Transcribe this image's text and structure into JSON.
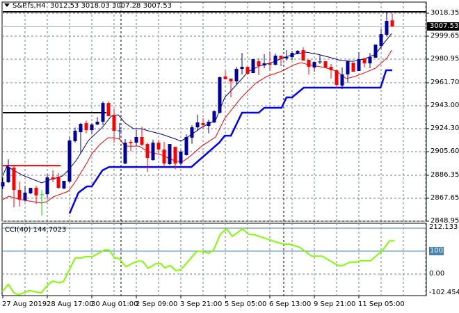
{
  "header": {
    "symbol": "S&P.fs,H4",
    "open": "3012.53",
    "high": "3018.03",
    "low": "3007.28",
    "close": "3007.53"
  },
  "colors": {
    "bull": "#0000a0",
    "bear": "#ff0000",
    "doji_special": "#00e000",
    "ma_fast": "#000080",
    "ma_slow": "#ff0000",
    "stop_line": "#0000ff",
    "cci_line": "#80ff00",
    "level_line": "#4682b4",
    "grid": "#708090"
  },
  "price_axis": {
    "labels": [
      "3018.35",
      "2999.65",
      "2980.95",
      "2961.70",
      "2943.00",
      "2924.30",
      "2905.60",
      "2886.35",
      "2867.65",
      "2848.95"
    ],
    "current_price": "3007.53",
    "range": [
      2848.95,
      3018.35
    ]
  },
  "time_axis": {
    "labels": [
      "27 Aug 2019",
      "28 Aug 17:00",
      "30 Aug 01:00",
      "2 Sep 09:00",
      "3 Sep 21:00",
      "5 Sep 05:00",
      "6 Sep 13:00",
      "9 Sep 21:00",
      "11 Sep 05:00"
    ]
  },
  "chart_data": {
    "type": "candlestick",
    "candles": [
      [
        2877.3,
        2884.6,
        2875.0,
        2880.7
      ],
      [
        2880.7,
        2899.3,
        2880.1,
        2893.1
      ],
      [
        2892.5,
        2894.2,
        2860.3,
        2874.4
      ],
      [
        2874.4,
        2881.2,
        2861.0,
        2866.5
      ],
      [
        2866.0,
        2877.6,
        2864.8,
        2872.2
      ],
      [
        2871.6,
        2875.2,
        2871.0,
        2876.1
      ],
      [
        2876.1,
        2877.8,
        2863.1,
        2869.9
      ],
      [
        2870.5,
        2874.4,
        2853.5,
        2870.5,
        "g"
      ],
      [
        2870.9,
        2887.4,
        2867.6,
        2884.6
      ],
      [
        2884.6,
        2890.3,
        2880.8,
        2882.9
      ],
      [
        2885.2,
        2888.2,
        2875.2,
        2876.1
      ],
      [
        2875.6,
        2881.8,
        2875.0,
        2881.8
      ],
      [
        2881.2,
        2917.7,
        2880.1,
        2914.7
      ],
      [
        2914.1,
        2925.2,
        2912.9,
        2922.6
      ],
      [
        2921.4,
        2929.0,
        2904.5,
        2928.2
      ],
      [
        2928.8,
        2930.9,
        2920.5,
        2923.1
      ],
      [
        2923.1,
        2929.0,
        2919.6,
        2927.7
      ],
      [
        2927.7,
        2933.7,
        2927.1,
        2930.0
      ],
      [
        2930.0,
        2946.6,
        2927.1,
        2945.2
      ],
      [
        2945.2,
        2946.6,
        2934.5,
        2934.5
      ],
      [
        2935.6,
        2940.3,
        2912.9,
        2922.6
      ],
      [
        2922.6,
        2928.8,
        2915.8,
        2922.6,
        "u"
      ],
      [
        2895.9,
        2915.8,
        2895.4,
        2912.9
      ],
      [
        2913.5,
        2915.3,
        2906.0,
        2912.4
      ],
      [
        2912.9,
        2923.3,
        2910.1,
        2917.5
      ],
      [
        2917.5,
        2925.8,
        2910.1,
        2911.2
      ],
      [
        2911.8,
        2912.9,
        2889.2,
        2900.5
      ],
      [
        2898.8,
        2915.4,
        2898.2,
        2912.9
      ],
      [
        2912.9,
        2915.4,
        2904.0,
        2907.3
      ],
      [
        2907.3,
        2913.5,
        2894.1,
        2895.9
      ],
      [
        2895.4,
        2911.8,
        2894.6,
        2911.8
      ],
      [
        2909.5,
        2909.5,
        2891.2,
        2895.9
      ],
      [
        2895.9,
        2906.9,
        2894.8,
        2905.6
      ],
      [
        2902.8,
        2919.7,
        2902.4,
        2917.5
      ],
      [
        2917.0,
        2927.1,
        2912.0,
        2925.4
      ],
      [
        2925.4,
        2935.6,
        2922.6,
        2929.4
      ],
      [
        2928.8,
        2932.8,
        2924.3,
        2927.1
      ],
      [
        2926.5,
        2931.7,
        2920.5,
        2930.0
      ],
      [
        2929.4,
        2939.4,
        2928.8,
        2938.5
      ],
      [
        2937.3,
        2966.8,
        2936.6,
        2966.2
      ],
      [
        2966.8,
        2971.5,
        2964.5,
        2964.5
      ],
      [
        2965.1,
        2965.1,
        2949.8,
        2962.8
      ],
      [
        2962.8,
        2974.7,
        2960.1,
        2973.0
      ],
      [
        2973.0,
        2986.0,
        2968.5,
        2974.7
      ],
      [
        2974.7,
        2974.7,
        2968.5,
        2969.0
      ],
      [
        2969.6,
        2980.9,
        2969.6,
        2980.9
      ],
      [
        2979.2,
        2981.5,
        2967.9,
        2975.3
      ],
      [
        2975.8,
        2984.9,
        2973.6,
        2977.5
      ],
      [
        2977.5,
        2987.2,
        2971.3,
        2976.4
      ],
      [
        2976.4,
        2985.5,
        2975.8,
        2983.8
      ],
      [
        2983.8,
        2983.8,
        2975.3,
        2981.5
      ],
      [
        2981.5,
        2988.3,
        2979.8,
        2982.6
      ],
      [
        2982.6,
        2987.7,
        2980.4,
        2986.0
      ],
      [
        2985.5,
        2988.3,
        2984.9,
        2987.7
      ],
      [
        2988.3,
        2990.7,
        2979.8,
        2979.8
      ],
      [
        2980.4,
        2980.4,
        2968.5,
        2974.7
      ],
      [
        2974.1,
        2978.7,
        2970.7,
        2978.7
      ],
      [
        2978.7,
        2984.4,
        2977.0,
        2978.7,
        "u"
      ],
      [
        2979.2,
        2979.2,
        2973.6,
        2974.1
      ],
      [
        2974.7,
        2977.0,
        2965.1,
        2971.9
      ],
      [
        2971.9,
        2971.9,
        2957.1,
        2960.0
      ],
      [
        2959.4,
        2974.1,
        2956.6,
        2968.5
      ],
      [
        2968.5,
        2979.8,
        2961.7,
        2979.2
      ],
      [
        2978.1,
        2978.1,
        2970.7,
        2970.7
      ],
      [
        2971.3,
        2986.6,
        2971.3,
        2980.9
      ],
      [
        2981.5,
        2982.1,
        2974.1,
        2977.5
      ],
      [
        2977.5,
        2986.0,
        2973.6,
        2982.6
      ],
      [
        2982.1,
        2992.8,
        2982.1,
        2992.8
      ],
      [
        2991.7,
        3005.3,
        2989.4,
        3001.3
      ],
      [
        3000.8,
        3019.5,
        2999.6,
        3012.1
      ],
      [
        3012.53,
        3018.03,
        3007.28,
        3007.53
      ]
    ],
    "ma_fast": [
      [
        1,
        2886.3
      ],
      [
        1.75,
        2893.7
      ],
      [
        3,
        2890.3
      ],
      [
        4.6,
        2886.3
      ],
      [
        8,
        2880.1
      ],
      [
        8.9,
        2881.8
      ],
      [
        11.75,
        2885.8
      ],
      [
        12.75,
        2890.3
      ],
      [
        14.25,
        2898.8
      ],
      [
        16.4,
        2914.7
      ],
      [
        18.9,
        2925.4
      ],
      [
        20.5,
        2934.5
      ],
      [
        21.75,
        2935.6
      ],
      [
        23,
        2928.8
      ],
      [
        24.5,
        2924.3
      ],
      [
        25.9,
        2924.3
      ],
      [
        27.1,
        2922.6
      ],
      [
        29.6,
        2919.7
      ],
      [
        32.1,
        2915.8
      ],
      [
        33,
        2914.1
      ],
      [
        34.6,
        2918.6
      ],
      [
        36.75,
        2925.4
      ],
      [
        39.25,
        2931.1
      ],
      [
        40.9,
        2949.8
      ],
      [
        43,
        2960.0
      ],
      [
        45.1,
        2970.7
      ],
      [
        47.1,
        2975.3
      ],
      [
        49.25,
        2978.1
      ],
      [
        51.75,
        2982.6
      ],
      [
        53.4,
        2984.9
      ],
      [
        55.5,
        2986.6
      ],
      [
        57.6,
        2984.9
      ],
      [
        59.6,
        2982.6
      ],
      [
        61.75,
        2979.8
      ],
      [
        63.9,
        2979.2
      ],
      [
        65.9,
        2980.9
      ],
      [
        68,
        2984.9
      ],
      [
        69,
        2991.1
      ],
      [
        70.9,
        3001.9
      ]
    ],
    "ma_slow": [
      [
        1,
        2866.5
      ],
      [
        2.1,
        2869.3
      ],
      [
        4.25,
        2866.5
      ],
      [
        8,
        2863.7
      ],
      [
        8.9,
        2864.8
      ],
      [
        10.1,
        2868.8
      ],
      [
        12.75,
        2873.3
      ],
      [
        13.9,
        2880.1
      ],
      [
        15.9,
        2894.8
      ],
      [
        17.1,
        2904.5
      ],
      [
        18.4,
        2911.2
      ],
      [
        19.9,
        2916.9
      ],
      [
        20.9,
        2916.9
      ],
      [
        22,
        2915.8
      ],
      [
        23,
        2910.1
      ],
      [
        25.5,
        2910.1
      ],
      [
        27.1,
        2905.6
      ],
      [
        29.6,
        2902.8
      ],
      [
        32.1,
        2897.7
      ],
      [
        33.4,
        2897.7
      ],
      [
        34.6,
        2901.6
      ],
      [
        36.75,
        2910.1
      ],
      [
        39.25,
        2917.5
      ],
      [
        40.9,
        2932.8
      ],
      [
        43.9,
        2949.8
      ],
      [
        46.4,
        2961.1
      ],
      [
        48.4,
        2966.8
      ],
      [
        50.9,
        2970.7
      ],
      [
        53.4,
        2976.4
      ],
      [
        54.6,
        2978.1
      ],
      [
        55.9,
        2976.4
      ],
      [
        58.9,
        2974.1
      ],
      [
        60.9,
        2971.3
      ],
      [
        62.75,
        2965.1
      ],
      [
        64.25,
        2966.8
      ],
      [
        65.9,
        2969.6
      ],
      [
        68,
        2973.6
      ],
      [
        70.1,
        2982.1
      ],
      [
        70.9,
        2988.3
      ]
    ],
    "stop_line": [
      [
        13,
        2855.2
      ],
      [
        14.6,
        2872.2
      ],
      [
        16.1,
        2877.3
      ],
      [
        17,
        2877.3
      ],
      [
        18.9,
        2890.3
      ],
      [
        20.1,
        2893.1
      ],
      [
        34.9,
        2893.1
      ],
      [
        39.9,
        2912.9
      ],
      [
        40.9,
        2918.6
      ],
      [
        42,
        2918.6
      ],
      [
        44,
        2937.3
      ],
      [
        47,
        2937.3
      ],
      [
        48,
        2941.3
      ],
      [
        51.1,
        2941.3
      ],
      [
        52,
        2949.8
      ],
      [
        53,
        2949.8
      ],
      [
        55.1,
        2957.7
      ],
      [
        68.9,
        2957.7
      ],
      [
        69.9,
        2971.9
      ],
      [
        71,
        2971.9
      ]
    ],
    "hlines": [
      {
        "price": 3019.5,
        "from": 0,
        "to": 80,
        "color": "#000000"
      },
      {
        "price": 2937.3,
        "from": 0,
        "to": 19.6,
        "color": "#000000"
      },
      {
        "price": 2894.2,
        "from": 0,
        "to": 11.4,
        "color": "#ff0000"
      }
    ],
    "period_separators": [
      22.25,
      51.5
    ],
    "cci": {
      "label": "CCI(40) 144.7023",
      "period": 40,
      "value": 144.7023,
      "scale_labels": [
        "212.133",
        "100",
        "0.00",
        "-102.4547"
      ],
      "levels": [
        100,
        200,
        -100
      ],
      "range": [
        -102.4547,
        212.133
      ],
      "points": [
        [
          0.9,
          -76
        ],
        [
          2,
          -45
        ],
        [
          3,
          -82
        ],
        [
          3.9,
          -90
        ],
        [
          5.75,
          -72
        ],
        [
          7.9,
          -82
        ],
        [
          9.25,
          -43
        ],
        [
          10,
          -31
        ],
        [
          11.1,
          -38
        ],
        [
          11.9,
          -33
        ],
        [
          14,
          70
        ],
        [
          15.25,
          70
        ],
        [
          15.9,
          76
        ],
        [
          17.1,
          76
        ],
        [
          18.25,
          91
        ],
        [
          19.25,
          105
        ],
        [
          20.1,
          105
        ],
        [
          21.1,
          70
        ],
        [
          21.9,
          68
        ],
        [
          23.1,
          32
        ],
        [
          25.1,
          56
        ],
        [
          26.1,
          56
        ],
        [
          27.1,
          25
        ],
        [
          28.5,
          45
        ],
        [
          29.4,
          45
        ],
        [
          30.1,
          27
        ],
        [
          31.1,
          37
        ],
        [
          32.1,
          15
        ],
        [
          33,
          19
        ],
        [
          35.9,
          100
        ],
        [
          37,
          98
        ],
        [
          38,
          90
        ],
        [
          38.9,
          106
        ],
        [
          40.1,
          174
        ],
        [
          41.25,
          197
        ],
        [
          42.25,
          164
        ],
        [
          44.1,
          197
        ],
        [
          45.1,
          174
        ],
        [
          46.25,
          171
        ],
        [
          49.1,
          148
        ],
        [
          51.25,
          131
        ],
        [
          52.6,
          130
        ],
        [
          54.4,
          116
        ],
        [
          56.5,
          78
        ],
        [
          58.4,
          78
        ],
        [
          61.25,
          37
        ],
        [
          62.1,
          37
        ],
        [
          63.4,
          52
        ],
        [
          64.5,
          52
        ],
        [
          65.25,
          58
        ],
        [
          67.1,
          58
        ],
        [
          69.25,
          103
        ],
        [
          70.5,
          144.7
        ],
        [
          71.4,
          144.7
        ]
      ]
    }
  }
}
